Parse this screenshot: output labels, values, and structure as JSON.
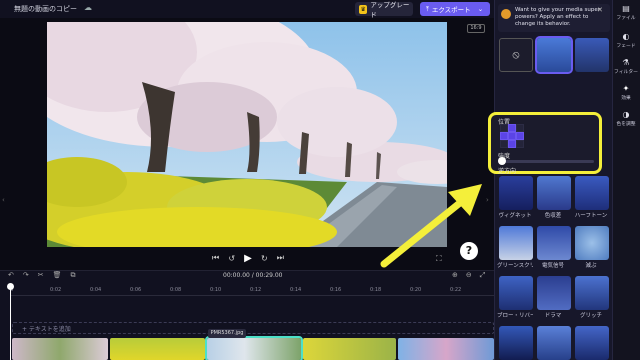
{
  "header": {
    "title": "無題の動画のコピー",
    "upgrade_label": "アップグレード",
    "export_label": "エクスポート"
  },
  "preview": {
    "aspect_label": "16:9"
  },
  "timeline": {
    "timecode": "00:00.00 / 00:29.00",
    "ticks": [
      "0",
      "0:02",
      "0:04",
      "0:06",
      "0:08",
      "0:10",
      "0:12",
      "0:14",
      "0:16",
      "0:18",
      "0:20",
      "0:22"
    ],
    "text_track_label": "+ テキストを追加",
    "tooltip_label": "PMR5367.jpg"
  },
  "notice": {
    "text": "Want to give your media super powers? Apply an effect to change its behavior."
  },
  "effects": {
    "labels": [
      [
        "",
        "",
        ""
      ],
      [
        "ヴィグネット",
        "色収差",
        "ハーフトーン"
      ],
      [
        "グリーンスクリーン",
        "電気信号",
        "減ぶ"
      ],
      [
        "ブロー・リバース",
        "ドラマ",
        "グリッチ"
      ]
    ]
  },
  "popup": {
    "position_label": "位置",
    "blur_label": "強度",
    "direction_label": "逆方向"
  },
  "rail": {
    "items": [
      "ファイル",
      "フェード",
      "フィルター",
      "効果",
      "色を調整"
    ]
  },
  "colors": {
    "accent": "#6a5cf0",
    "highlight": "#f4ef3a",
    "selected_clip": "#4de0c8"
  }
}
